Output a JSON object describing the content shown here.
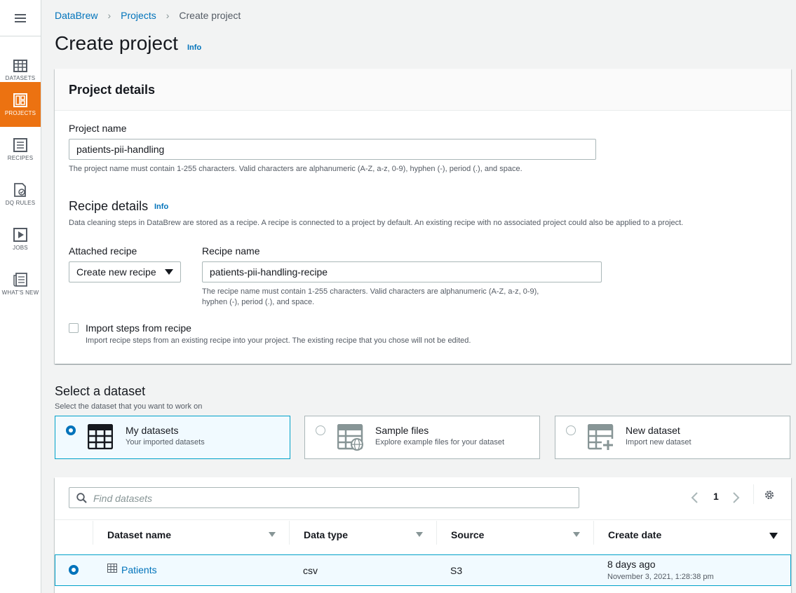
{
  "sidebar": {
    "items": [
      {
        "label": "DATASETS",
        "icon": "table-icon"
      },
      {
        "label": "PROJECTS",
        "icon": "project-grid-icon"
      },
      {
        "label": "RECIPES",
        "icon": "list-icon"
      },
      {
        "label": "DQ RULES",
        "icon": "rule-check-icon"
      },
      {
        "label": "JOBS",
        "icon": "play-icon"
      },
      {
        "label": "WHAT'S NEW",
        "icon": "news-icon"
      }
    ],
    "active": "PROJECTS",
    "accent": "#ec7211"
  },
  "breadcrumb": [
    "DataBrew",
    "Projects",
    "Create project"
  ],
  "page": {
    "title": "Create project",
    "info_label": "Info"
  },
  "project_details": {
    "heading": "Project details",
    "name_label": "Project name",
    "name_value": "patients-pii-handling",
    "name_hint": "The project name must contain 1-255 characters. Valid characters are alphanumeric (A-Z, a-z, 0-9), hyphen (-), period (.), and space."
  },
  "recipe_details": {
    "heading": "Recipe details",
    "info_label": "Info",
    "description": "Data cleaning steps in DataBrew are stored as a recipe. A recipe is connected to a project by default. An existing recipe with no associated project could also be applied to a project.",
    "attached_label": "Attached recipe",
    "attached_value": "Create new recipe",
    "recipe_name_label": "Recipe name",
    "recipe_name_value": "patients-pii-handling-recipe",
    "recipe_name_hint_1": "The recipe name must contain 1-255 characters. Valid characters are alphanumeric (A-Z, a-z, 0-9),",
    "recipe_name_hint_2": "hyphen (-), period (.), and space.",
    "import_label": "Import steps from recipe",
    "import_hint": "Import recipe steps from an existing recipe into your project. The existing recipe that you chose will not be edited.",
    "import_checked": false
  },
  "dataset_select": {
    "heading": "Select a dataset",
    "description": "Select the dataset that you want to work on",
    "tiles": [
      {
        "title": "My datasets",
        "desc": "Your imported datasets",
        "selected": true,
        "icon": "table-icon"
      },
      {
        "title": "Sample files",
        "desc": "Explore example files for your dataset",
        "selected": false,
        "icon": "sample-table-icon"
      },
      {
        "title": "New dataset",
        "desc": "Import new dataset",
        "selected": false,
        "icon": "add-table-icon"
      }
    ]
  },
  "dataset_table": {
    "search_placeholder": "Find datasets",
    "page": "1",
    "columns": [
      "Dataset name",
      "Data type",
      "Source",
      "Create date"
    ],
    "rows": [
      {
        "name": "Patients",
        "type": "csv",
        "source": "S3",
        "date_relative": "8 days ago",
        "date_full": "November 3, 2021, 1:28:38 pm",
        "selected": true
      }
    ]
  },
  "colors": {
    "link": "#0073bb",
    "selected_bg": "#f1faff",
    "selected_border": "#00a1c9"
  }
}
